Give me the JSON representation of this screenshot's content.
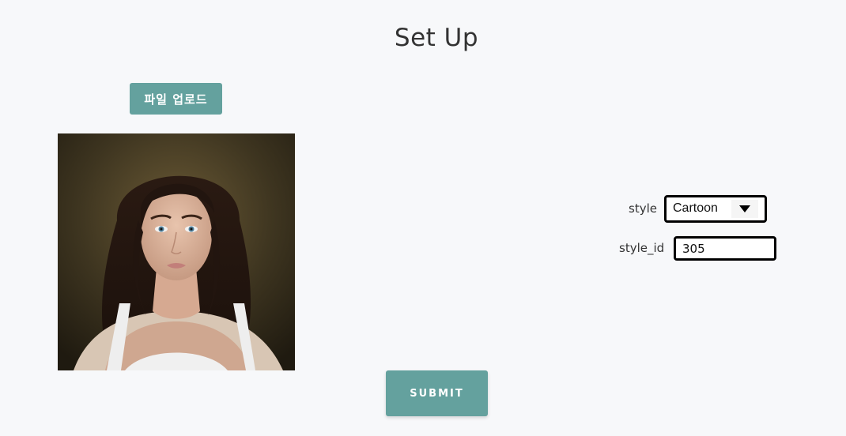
{
  "header": {
    "title": "Set Up"
  },
  "upload": {
    "button_label": "파일 업로드"
  },
  "preview": {
    "alt": "uploaded portrait photo"
  },
  "form": {
    "style_label": "style",
    "style_value": "Cartoon",
    "style_id_label": "style_id",
    "style_id_value": "305"
  },
  "actions": {
    "submit_label": "SUBMIT"
  },
  "colors": {
    "background": "#f7f8fa",
    "accent": "#64a19e",
    "border": "#000000"
  },
  "icons": {
    "select_arrow": "chevron-down-icon"
  }
}
